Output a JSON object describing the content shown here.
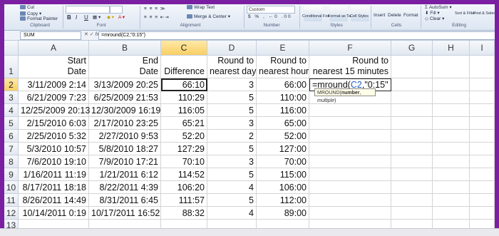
{
  "ribbon": {
    "clipboard": {
      "cut": "Cut",
      "copy": "Copy",
      "format_painter": "Format Painter",
      "group": "Clipboard"
    },
    "font": {
      "bold": "B",
      "italic": "I",
      "underline": "U",
      "group": "Font"
    },
    "alignment": {
      "wrap_text": "Wrap Text",
      "merge_center": "Merge & Center",
      "group": "Alignment"
    },
    "number": {
      "format": "Custom",
      "group": "Number"
    },
    "styles": {
      "conditional": "Conditional Formatting",
      "format_table": "Format as Table",
      "cell_styles": "Cell Styles",
      "group": "Styles"
    },
    "cells": {
      "insert": "Insert",
      "delete": "Delete",
      "format": "Format",
      "group": "Cells"
    },
    "editing": {
      "autosum": "AutoSum",
      "fill": "Fill",
      "clear": "Clear",
      "sort_filter": "Sort & Filter",
      "find_select": "Find & Select",
      "group": "Editing"
    }
  },
  "formula_bar": {
    "name_box": "SUM",
    "fx": "fx",
    "formula": "=mround(C2,\"0:15\")"
  },
  "columns": [
    "A",
    "B",
    "C",
    "D",
    "E",
    "F",
    "G",
    "H",
    "I"
  ],
  "rows": [
    "1",
    "2",
    "3",
    "4",
    "5",
    "6",
    "7",
    "8",
    "9",
    "10",
    "11",
    "12",
    "13"
  ],
  "headers": {
    "a1": [
      "Start",
      "Date"
    ],
    "b1": [
      "End",
      "Date"
    ],
    "c1": [
      "",
      "Difference"
    ],
    "d1": [
      "Round to",
      "nearest day"
    ],
    "e1": [
      "Round to",
      "nearest hour"
    ],
    "f1": [
      "Round to",
      "nearest 15 minutes"
    ]
  },
  "data_rows": [
    {
      "a": "3/11/2009 2:14",
      "b": "3/13/2009 20:25",
      "c": "66:10",
      "d": "3",
      "e": "66:00"
    },
    {
      "a": "6/21/2009 7:23",
      "b": "6/25/2009 21:53",
      "c": "110:29",
      "d": "5",
      "e": "110:00"
    },
    {
      "a": "12/25/2009 20:13",
      "b": "12/30/2009 16:19",
      "c": "116:05",
      "d": "5",
      "e": "116:00"
    },
    {
      "a": "2/15/2010 6:03",
      "b": "2/17/2010 23:25",
      "c": "65:21",
      "d": "3",
      "e": "65:00"
    },
    {
      "a": "2/25/2010 5:32",
      "b": "2/27/2010 9:53",
      "c": "52:20",
      "d": "2",
      "e": "52:00"
    },
    {
      "a": "5/3/2010 10:57",
      "b": "5/8/2010 18:27",
      "c": "127:29",
      "d": "5",
      "e": "127:00"
    },
    {
      "a": "7/6/2010 19:10",
      "b": "7/9/2010 17:21",
      "c": "70:10",
      "d": "3",
      "e": "70:00"
    },
    {
      "a": "1/16/2011 11:19",
      "b": "1/21/2011 6:12",
      "c": "114:52",
      "d": "5",
      "e": "115:00"
    },
    {
      "a": "8/17/2011 18:18",
      "b": "8/22/2011 4:39",
      "c": "106:20",
      "d": "4",
      "e": "106:00"
    },
    {
      "a": "8/26/2011 14:49",
      "b": "8/31/2011 6:45",
      "c": "111:57",
      "d": "5",
      "e": "112:00"
    },
    {
      "a": "10/14/2011 0:19",
      "b": "10/17/2011 16:52",
      "c": "88:32",
      "d": "4",
      "e": "89:00"
    }
  ],
  "edit_cell": {
    "prefix": "=mround(",
    "ref": "C2",
    "suffix": ",\"0:15\""
  },
  "tooltip": {
    "fn": "MROUND(",
    "arg1": "number",
    "sep": ", ",
    "arg2": "multiple",
    "end": ")"
  }
}
